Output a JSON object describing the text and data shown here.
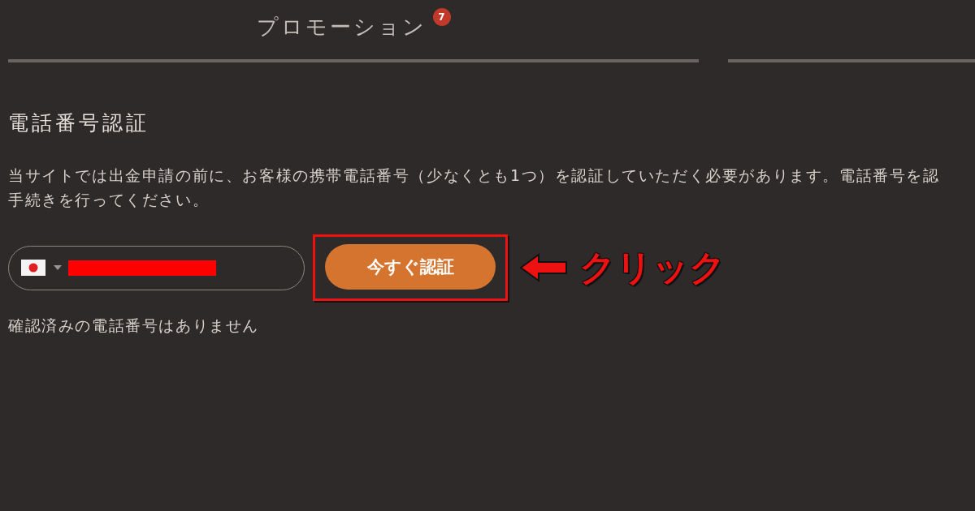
{
  "tabs": [
    {
      "label": "プロモーション",
      "badge": "7"
    }
  ],
  "section": {
    "title": "電話番号認証",
    "description_lines": [
      "当サイトでは出金申請の前に、お客様の携帯電話番号（少なくとも1つ）を認証していただく必要があります。電話番号を認",
      "手続きを行ってください。"
    ],
    "phone_field": {
      "redacted": true
    },
    "verify_button": "今すぐ認証",
    "note": "確認済みの電話番号はありません"
  },
  "annotation": {
    "highlighted": true,
    "label": "クリック"
  }
}
